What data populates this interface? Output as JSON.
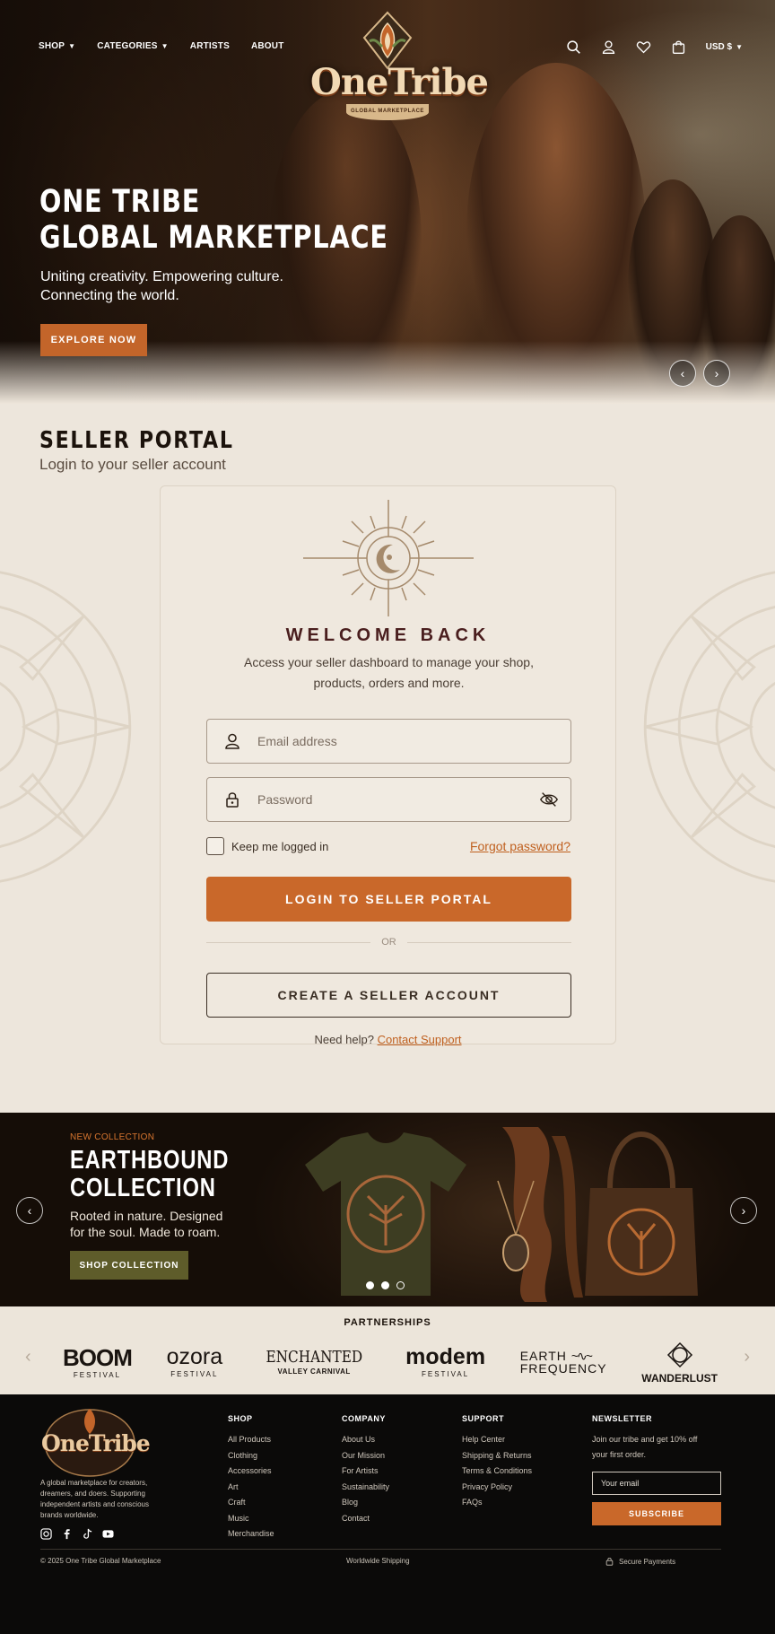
{
  "nav": {
    "left": [
      {
        "label": "SHOP",
        "has_dropdown": true
      },
      {
        "label": "CATEGORIES",
        "has_dropdown": true
      },
      {
        "label": "ARTISTS",
        "has_dropdown": false
      },
      {
        "label": "ABOUT",
        "has_dropdown": false
      }
    ],
    "currency": "USD $",
    "icons": [
      "search-icon",
      "account-icon",
      "wishlist-icon",
      "cart-icon"
    ]
  },
  "logo": {
    "text": "OneTribe",
    "sub": "GLOBAL MARKETPLACE"
  },
  "hero": {
    "title_line1": "ONE TRIBE",
    "title_line2": "GLOBAL MARKETPLACE",
    "subtitle": "Uniting creativity. Empowering culture. Connecting the world.",
    "cta": "EXPLORE NOW"
  },
  "seller": {
    "title": "SELLER PORTAL",
    "subtitle": "Login to your seller account",
    "welcome": "WELCOME BACK",
    "access": "Access your seller dashboard to manage your shop, products, orders and more.",
    "email_placeholder": "Email address",
    "password_placeholder": "Password",
    "remember": "Keep me logged in",
    "forgot": "Forgot password?",
    "login_button": "LOGIN TO SELLER PORTAL",
    "or": "OR",
    "create_button": "CREATE A SELLER ACCOUNT",
    "help_text": "Need help?",
    "help_link": "Contact Support"
  },
  "collection": {
    "kicker": "NEW COLLECTION",
    "title_line1": "EARTHBOUND",
    "title_line2": "COLLECTION",
    "description": "Rooted in nature. Designed for the soul. Made to roam.",
    "cta": "SHOP COLLECTION",
    "slides": 3,
    "active_slide": 2
  },
  "partnerships": {
    "title": "PARTNERSHIPS",
    "logos": [
      {
        "big": "BOOM",
        "small": "FESTIVAL"
      },
      {
        "big": "ozora",
        "small": "FESTIVAL"
      },
      {
        "big": "ENCHANTED",
        "small": "VALLEY CARNIVAL"
      },
      {
        "big": "modem",
        "small": "FESTIVAL"
      },
      {
        "big": "EARTH",
        "big2": "FREQUENCY"
      },
      {
        "big": "WANDERLUST"
      }
    ]
  },
  "footer": {
    "logo_text": "OneTribe",
    "about": "A global marketplace for creators, dreamers, and doers. Supporting independent artists and conscious brands worldwide.",
    "shop": {
      "title": "SHOP",
      "links": [
        "All Products",
        "Clothing",
        "Accessories",
        "Art",
        "Craft",
        "Music",
        "Merchandise"
      ]
    },
    "company": {
      "title": "COMPANY",
      "links": [
        "About Us",
        "Our Mission",
        "For Artists",
        "Sustainability",
        "Blog",
        "Contact"
      ]
    },
    "support": {
      "title": "SUPPORT",
      "links": [
        "Help Center",
        "Shipping & Returns",
        "Terms & Conditions",
        "Privacy Policy",
        "FAQs"
      ]
    },
    "newsletter": {
      "title": "NEWSLETTER",
      "text": "Join our tribe and get 10% off your first order.",
      "placeholder": "Your email",
      "button": "SUBSCRIBE"
    },
    "copyright": "© 2025 One Tribe Global Marketplace",
    "shipping": "Worldwide Shipping",
    "payments": "Secure Payments"
  },
  "colors": {
    "accent": "#c9682a",
    "dark": "#0b0a09",
    "cream": "#ede6dc",
    "olive": "#5e5c2a",
    "maroon": "#4a1e1e"
  }
}
